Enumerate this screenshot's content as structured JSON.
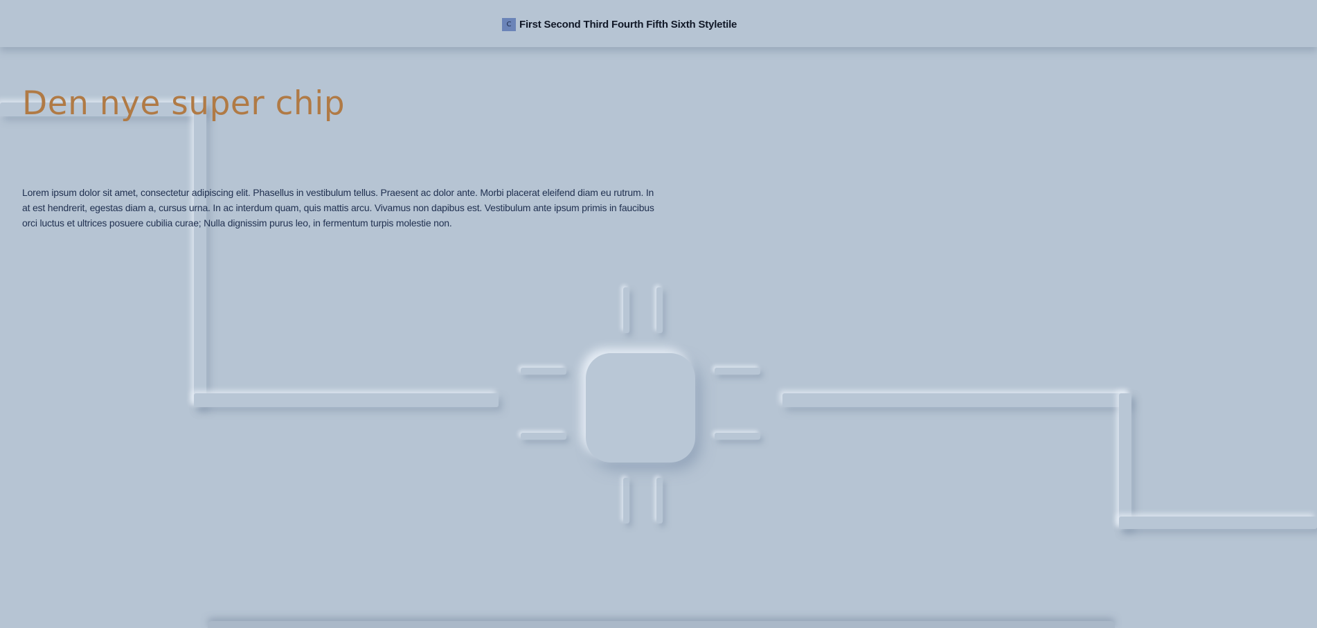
{
  "header": {
    "logo_letter": "C",
    "nav": [
      "First",
      "Second",
      "Third",
      "Fourth",
      "Fifth",
      "Sixth",
      "Styletile"
    ]
  },
  "main": {
    "title": "Den nye super chip",
    "paragraph": "Lorem ipsum dolor sit amet, consectetur adipiscing elit. Phasellus in vestibulum tellus. Praesent ac dolor ante. Morbi placerat eleifend diam eu rutrum. In at est hendrerit, egestas diam a, cursus urna. In ac interdum quam, quis mattis arcu. Vivamus non dapibus est. Vestibulum ante ipsum primis in faucibus orci luctus et ultrices posuere cubilia curae; Nulla dignissim purus leo, in fermentum turpis molestie non."
  },
  "colors": {
    "background": "#b6c4d3",
    "title": "#b07a45",
    "text": "#1f2f4f",
    "logo": "#6b84b8"
  }
}
